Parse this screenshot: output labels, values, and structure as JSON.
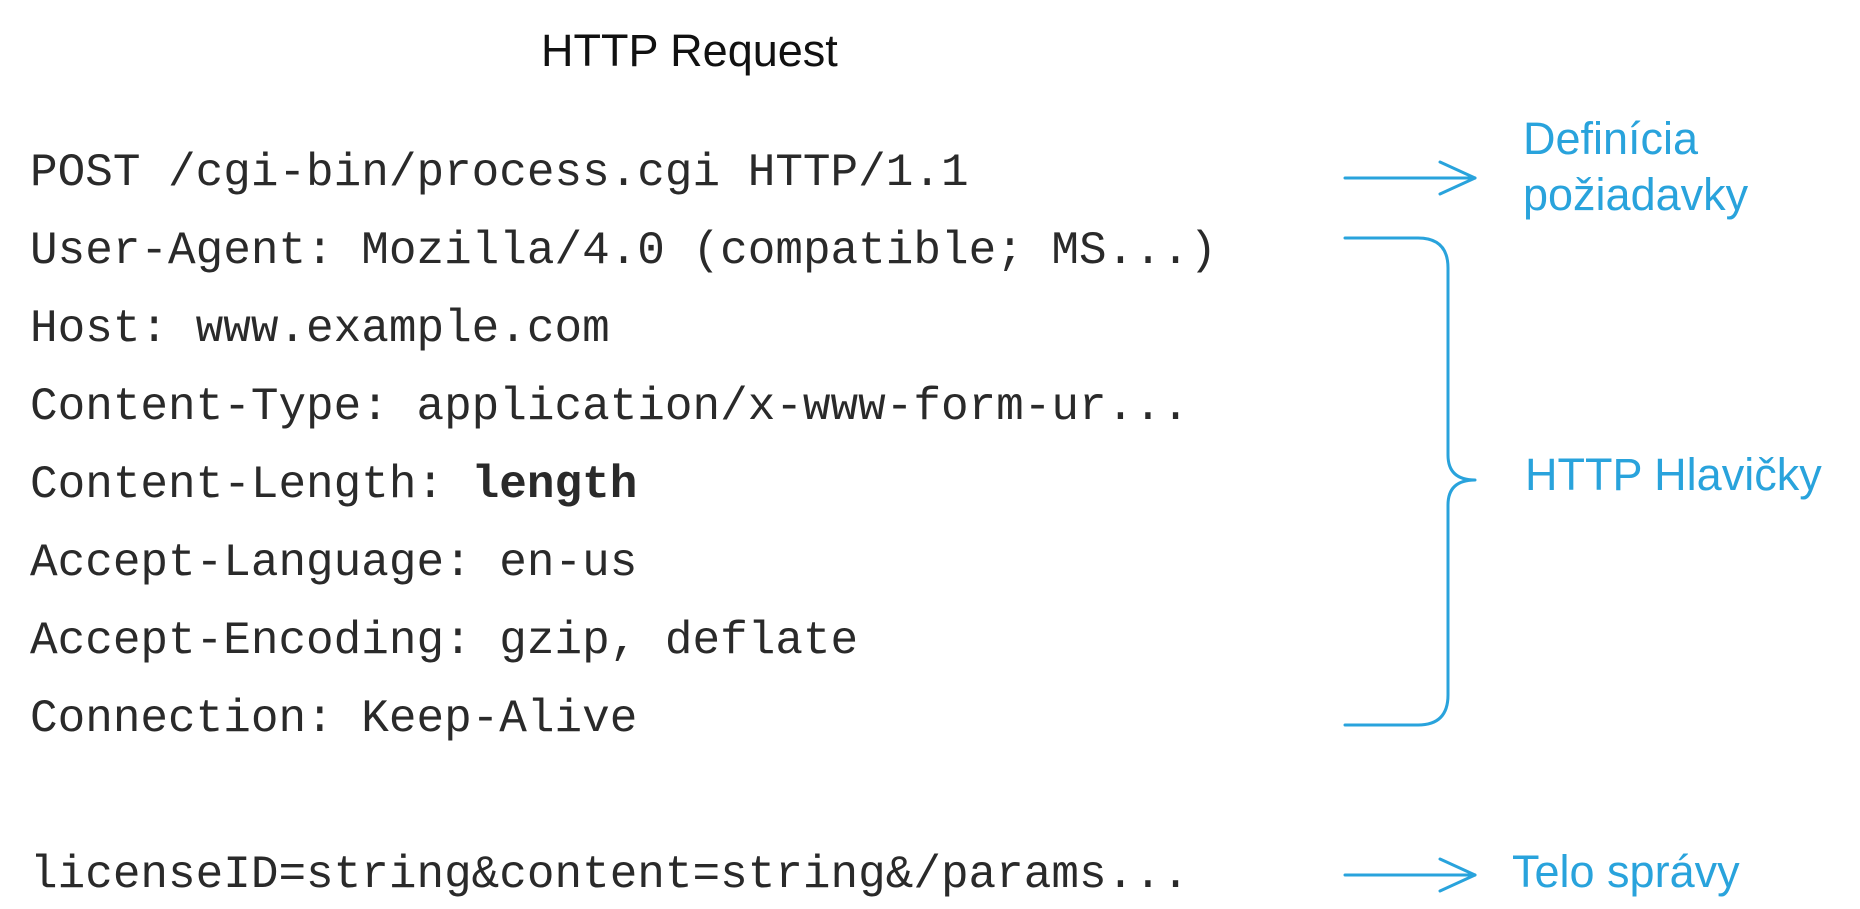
{
  "title": "HTTP Request",
  "request_lines": [
    {
      "key": "POST /cgi-bin/process.cgi HTTP/1.1",
      "value": ""
    },
    {
      "key": "User-Agent: ",
      "value": "Mozilla/4.0 (compatible; MS...)"
    },
    {
      "key": "Host: ",
      "value": "www.example.com"
    },
    {
      "key": "Content-Type: ",
      "value": "application/x-www-form-ur..."
    },
    {
      "key": "Content-Length: ",
      "value": "length"
    },
    {
      "key": "Accept-Language: ",
      "value": "en-us"
    },
    {
      "key": "Accept-Encoding: ",
      "value": "gzip, deflate"
    },
    {
      "key": "Connection: ",
      "value": "Keep-Alive"
    }
  ],
  "body_line": "licenseID=string&content=string&/params...",
  "annotations": {
    "request_definition": [
      "Definícia",
      "požiadavky"
    ],
    "headers": "HTTP Hlavičky",
    "body": "Telo správy"
  },
  "colors": {
    "accent": "#29a3dc",
    "code": "#2a2a2a",
    "title": "#111111"
  }
}
